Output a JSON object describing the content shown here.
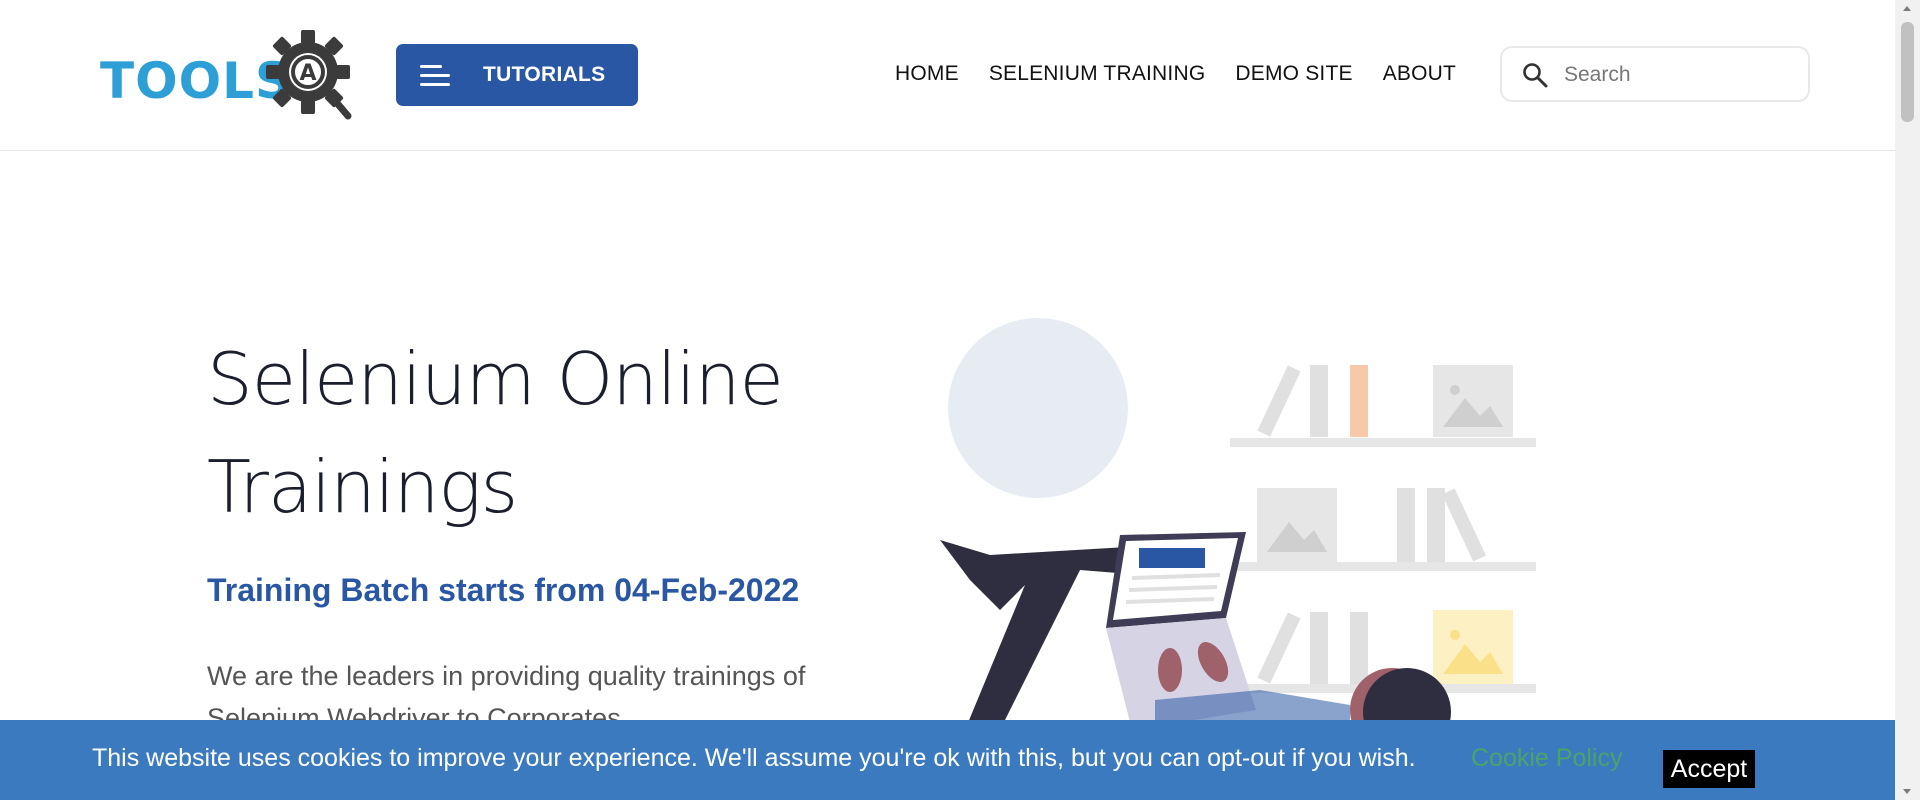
{
  "header": {
    "logo_text": "TOOLS",
    "logo_letter": "A",
    "tutorials_label": "TUTORIALS",
    "nav": [
      "HOME",
      "SELENIUM TRAINING",
      "DEMO SITE",
      "ABOUT"
    ],
    "search_placeholder": "Search"
  },
  "hero": {
    "title": "Selenium Online Trainings",
    "subtitle": "Training Batch starts from 04-Feb-2022",
    "body": "We are the leaders in providing quality trainings of Selenium Webdriver to Corporates"
  },
  "cookie": {
    "message": "This website uses cookies to improve your experience. We'll assume you're ok with this, but you can opt-out if you wish.",
    "policy_link": "Cookie Policy",
    "accept_label": "Accept"
  },
  "colors": {
    "brand_blue": "#2a57a4",
    "logo_blue": "#2e9fd6",
    "cookie_bar": "#3c7ac0",
    "policy_green": "#49a36a"
  },
  "icons": {
    "menu": "hamburger-icon",
    "search": "search-icon",
    "logo": "gear-icon"
  }
}
